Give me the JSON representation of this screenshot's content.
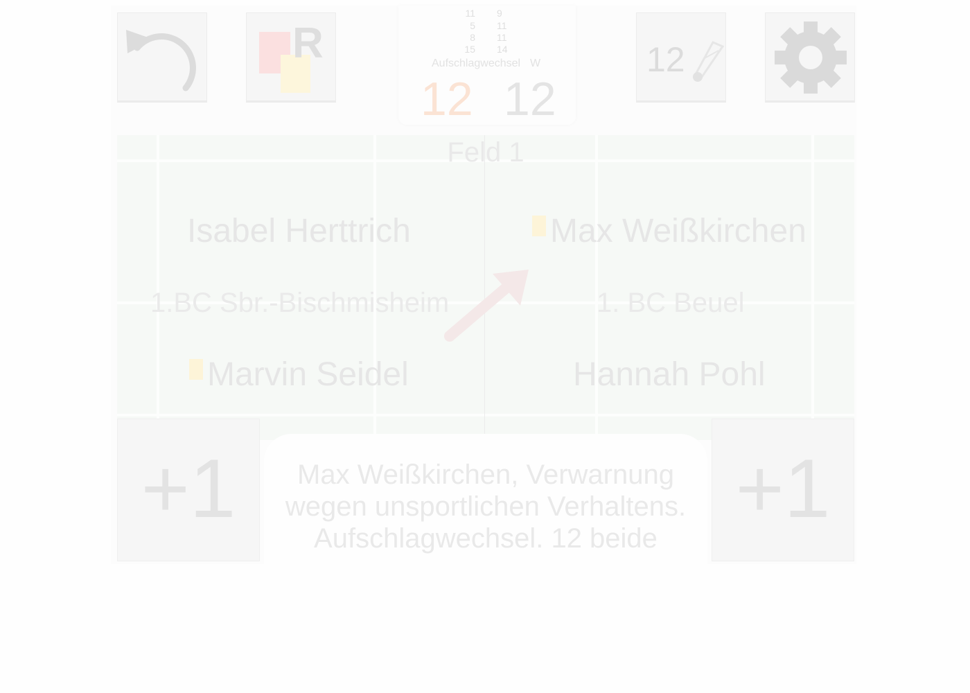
{
  "scoreboard": {
    "games": [
      {
        "left": "11",
        "right": "9"
      },
      {
        "left": "5",
        "right": "11"
      },
      {
        "left": "8",
        "right": "11"
      },
      {
        "left": "15",
        "right": "14"
      }
    ],
    "serve_label": "Aufschlagwechsel",
    "serve_side": "W",
    "score_left": "12",
    "score_right": "12"
  },
  "toolbar": {
    "undo_icon": "undo-icon",
    "cards_letter": "R",
    "shuttle_count": "12",
    "shuttle_icon": "shuttlecock-icon",
    "settings_icon": "gear-icon"
  },
  "court": {
    "name": "Feld 1",
    "left_team": "1.BC Sbr.-Bischmisheim",
    "right_team": "1. BC Beuel",
    "left_top_player": "Isabel Herttrich",
    "left_bottom_player": "Marvin Seidel",
    "right_top_player": "Max Weißkirchen",
    "right_bottom_player": "Hannah Pohl"
  },
  "buttons": {
    "plus_left": "+1",
    "plus_right": "+1"
  },
  "announcement": {
    "line1": "Max Weißkirchen, Verwarnung",
    "line2": "wegen unsportlichen Verhaltens.",
    "line3": "Aufschlagwechsel. 12 beide"
  },
  "colors": {
    "red_card": "#fbe0e0",
    "yellow_card": "#fdf4d8",
    "serving_score": "#fbe3d4",
    "court": "#f6f9f6"
  }
}
